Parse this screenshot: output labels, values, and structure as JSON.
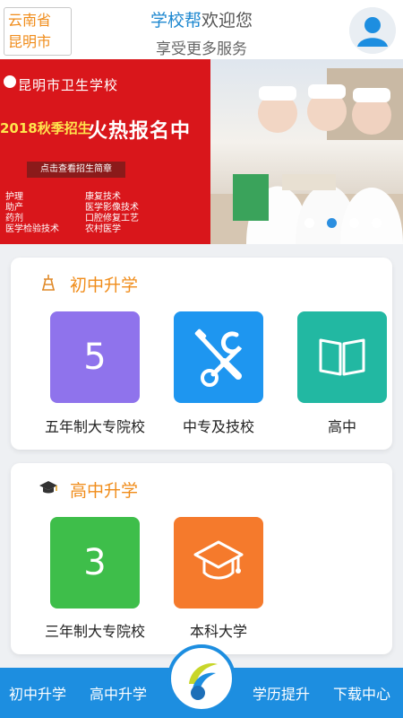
{
  "header": {
    "location_line1": "云南省",
    "location_line2": "昆明市",
    "brand": "学校帮",
    "welcome": "欢迎您",
    "subtitle": "享受更多服务"
  },
  "banner": {
    "school_name": "昆明市卫生学校",
    "enroll_year_text": "2018秋季招生",
    "hot_text": "火热报名中",
    "button_text": "点击查看招生简章",
    "majors_left": [
      "护理",
      "助产",
      "药剂",
      "医学检验技术"
    ],
    "majors_right": [
      "康复技术",
      "医学影像技术",
      "口腔修复工艺",
      "农村医学"
    ],
    "dots_count": 4,
    "active_dot": 1
  },
  "sections": [
    {
      "title": "初中升学",
      "icon": "tower-icon",
      "items": [
        {
          "label": "五年制大专院校",
          "symbol": "5",
          "color": "#8f73ec"
        },
        {
          "label": "中专及技校",
          "icon": "tools-icon",
          "color": "#1e96f0"
        },
        {
          "label": "高中",
          "icon": "book-icon",
          "color": "#22b8a2"
        }
      ]
    },
    {
      "title": "高中升学",
      "icon": "graduation-cap-icon",
      "items": [
        {
          "label": "三年制大专院校",
          "symbol": "3",
          "color": "#3ebe4a"
        },
        {
          "label": "本科大学",
          "icon": "university-icon",
          "color": "#f57a2c"
        }
      ]
    }
  ],
  "bottom_nav": {
    "items": [
      "初中升学",
      "高中升学",
      "学历提升",
      "下载中心"
    ]
  },
  "colors": {
    "primary": "#1d8ee0",
    "accent": "#f08c1a",
    "banner_red": "#d9161b"
  }
}
